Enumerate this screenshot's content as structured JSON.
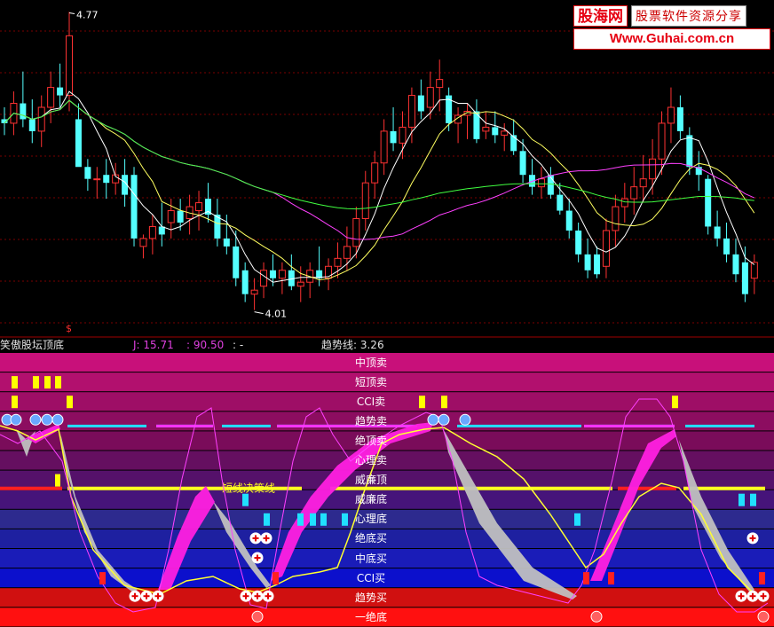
{
  "logo": {
    "site_cn": "股海网",
    "tagline": "股票软件资源分享",
    "url": "Www.Guhai.com.cn"
  },
  "price_panel": {
    "high_label": "4.77",
    "low_label": "4.01",
    "marker": "$",
    "candles": [
      [
        4.5,
        4.53,
        4.46,
        4.49
      ],
      [
        4.49,
        4.57,
        4.46,
        4.54
      ],
      [
        4.54,
        4.62,
        4.48,
        4.5
      ],
      [
        4.5,
        4.55,
        4.44,
        4.47
      ],
      [
        4.47,
        4.56,
        4.43,
        4.53
      ],
      [
        4.53,
        4.62,
        4.49,
        4.58
      ],
      [
        4.58,
        4.64,
        4.53,
        4.56
      ],
      [
        4.56,
        4.77,
        4.52,
        4.71
      ],
      [
        4.5,
        4.54,
        4.4,
        4.38
      ],
      [
        4.38,
        4.4,
        4.32,
        4.35
      ],
      [
        4.35,
        4.38,
        4.3,
        4.35
      ],
      [
        4.36,
        4.4,
        4.3,
        4.34
      ],
      [
        4.34,
        4.39,
        4.31,
        4.36
      ],
      [
        4.36,
        4.4,
        4.28,
        4.31
      ],
      [
        4.36,
        4.38,
        4.18,
        4.2
      ],
      [
        4.18,
        4.21,
        4.15,
        4.2
      ],
      [
        4.2,
        4.26,
        4.16,
        4.23
      ],
      [
        4.23,
        4.29,
        4.18,
        4.21
      ],
      [
        4.24,
        4.3,
        4.2,
        4.27
      ],
      [
        4.27,
        4.3,
        4.22,
        4.24
      ],
      [
        4.25,
        4.31,
        4.21,
        4.28
      ],
      [
        4.27,
        4.32,
        4.22,
        4.29
      ],
      [
        4.3,
        4.34,
        4.24,
        4.26
      ],
      [
        4.26,
        4.3,
        4.18,
        4.2
      ],
      [
        4.2,
        4.26,
        4.16,
        4.18
      ],
      [
        4.18,
        4.22,
        4.08,
        4.1
      ],
      [
        4.12,
        4.14,
        4.04,
        4.06
      ],
      [
        4.06,
        4.1,
        4.02,
        4.07
      ],
      [
        4.08,
        4.14,
        4.05,
        4.12
      ],
      [
        4.12,
        4.16,
        4.08,
        4.1
      ],
      [
        4.1,
        4.14,
        4.06,
        4.12
      ],
      [
        4.12,
        4.16,
        4.07,
        4.08
      ],
      [
        4.08,
        4.13,
        4.04,
        4.09
      ],
      [
        4.09,
        4.14,
        4.05,
        4.12
      ],
      [
        4.12,
        4.18,
        4.08,
        4.1
      ],
      [
        4.1,
        4.15,
        4.07,
        4.13
      ],
      [
        4.13,
        4.19,
        4.1,
        4.15
      ],
      [
        4.15,
        4.23,
        4.12,
        4.18
      ],
      [
        4.18,
        4.28,
        4.15,
        4.25
      ],
      [
        4.25,
        4.37,
        4.22,
        4.34
      ],
      [
        4.34,
        4.42,
        4.3,
        4.39
      ],
      [
        4.39,
        4.5,
        4.36,
        4.47
      ],
      [
        4.47,
        4.53,
        4.42,
        4.44
      ],
      [
        4.44,
        4.52,
        4.4,
        4.48
      ],
      [
        4.48,
        4.58,
        4.44,
        4.56
      ],
      [
        4.56,
        4.6,
        4.5,
        4.52
      ],
      [
        4.53,
        4.62,
        4.5,
        4.58
      ],
      [
        4.58,
        4.65,
        4.52,
        4.6
      ],
      [
        4.56,
        4.58,
        4.47,
        4.49
      ],
      [
        4.49,
        4.53,
        4.44,
        4.51
      ],
      [
        4.51,
        4.54,
        4.45,
        4.52
      ],
      [
        4.52,
        4.55,
        4.44,
        4.45
      ],
      [
        4.47,
        4.52,
        4.45,
        4.48
      ],
      [
        4.48,
        4.52,
        4.44,
        4.46
      ],
      [
        4.46,
        4.49,
        4.42,
        4.47
      ],
      [
        4.46,
        4.5,
        4.41,
        4.42
      ],
      [
        4.42,
        4.45,
        4.34,
        4.36
      ],
      [
        4.36,
        4.4,
        4.31,
        4.33
      ],
      [
        4.33,
        4.38,
        4.3,
        4.35
      ],
      [
        4.36,
        4.38,
        4.3,
        4.31
      ],
      [
        4.31,
        4.34,
        4.26,
        4.27
      ],
      [
        4.27,
        4.3,
        4.2,
        4.22
      ],
      [
        4.22,
        4.24,
        4.14,
        4.16
      ],
      [
        4.16,
        4.2,
        4.1,
        4.12
      ],
      [
        4.16,
        4.18,
        4.1,
        4.11
      ],
      [
        4.13,
        4.25,
        4.1,
        4.22
      ],
      [
        4.22,
        4.31,
        4.18,
        4.28
      ],
      [
        4.28,
        4.34,
        4.24,
        4.3
      ],
      [
        4.3,
        4.38,
        4.26,
        4.33
      ],
      [
        4.33,
        4.41,
        4.29,
        4.35
      ],
      [
        4.35,
        4.45,
        4.31,
        4.4
      ],
      [
        4.4,
        4.52,
        4.36,
        4.49
      ],
      [
        4.49,
        4.58,
        4.44,
        4.53
      ],
      [
        4.53,
        4.56,
        4.45,
        4.47
      ],
      [
        4.46,
        4.48,
        4.36,
        4.38
      ],
      [
        4.38,
        4.42,
        4.32,
        4.36
      ],
      [
        4.35,
        4.36,
        4.21,
        4.23
      ],
      [
        4.23,
        4.27,
        4.18,
        4.2
      ],
      [
        4.2,
        4.24,
        4.14,
        4.16
      ],
      [
        4.16,
        4.2,
        4.09,
        4.11
      ],
      [
        4.14,
        4.18,
        4.04,
        4.06
      ],
      [
        4.1,
        4.16,
        4.06,
        4.14
      ]
    ]
  },
  "indicator": {
    "name": "笑傲股坛顶底",
    "j_label": "J: 15.71",
    "val2_label": ": 90.50",
    "val3_label": ": -",
    "trend_label": "趋势线: 3.26",
    "overlay_text": "短线决策线",
    "bands": [
      {
        "label": "中顶卖",
        "color": "#c8107a"
      },
      {
        "label": "短顶卖",
        "color": "#b2106e"
      },
      {
        "label": "CCI卖",
        "color": "#9e0e66"
      },
      {
        "label": "趋势卖",
        "color": "#8c0d60"
      },
      {
        "label": "绝顶卖",
        "color": "#7a0c5a"
      },
      {
        "label": "心理卖",
        "color": "#650f60"
      },
      {
        "label": "威廉顶",
        "color": "#55116a"
      },
      {
        "label": "威廉底",
        "color": "#46147a"
      },
      {
        "label": "心理底",
        "color": "#2d2a8e"
      },
      {
        "label": "绝底买",
        "color": "#1e20a0"
      },
      {
        "label": "中底买",
        "color": "#1a1cb8"
      },
      {
        "label": "CCI买",
        "color": "#0c10cc"
      },
      {
        "label": "趋势买",
        "color": "#d01010"
      },
      {
        "label": "一绝底",
        "color": "#ff1010"
      }
    ],
    "markers": {
      "short_top_sell": [
        16,
        40,
        53,
        65
      ],
      "cci_sell": [
        16,
        78,
        475,
        500,
        760
      ],
      "trend_sell_balls": [
        8,
        18,
        40,
        53,
        65,
        488,
        500,
        524
      ],
      "absolute_bottom_buy": [
        288,
        300,
        848
      ],
      "mid_bottom_buy": [
        290
      ],
      "trend_buy": [
        152,
        165,
        178,
        277,
        290,
        302,
        835,
        848,
        860
      ],
      "one_bottom": [
        290,
        672,
        860
      ],
      "psych_bottom": [
        300,
        338,
        352,
        364,
        388,
        650
      ],
      "william_bottom": [
        276,
        835,
        848
      ],
      "cci_buy": [
        115,
        310,
        660,
        688,
        858
      ]
    }
  }
}
